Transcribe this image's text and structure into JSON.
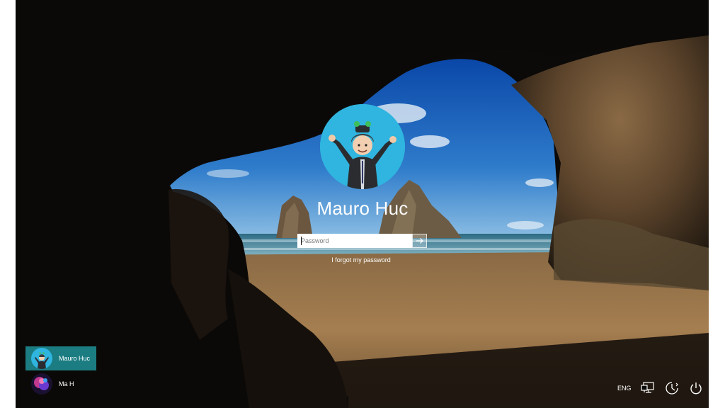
{
  "login": {
    "user_name": "Mauro Huc",
    "password_placeholder": "Password",
    "forgot_password": "I forgot my password",
    "submit_icon": "arrow-right-icon"
  },
  "user_list": [
    {
      "name": "Mauro Huc",
      "selected": true,
      "avatar_icon": "cartoon-avatar-icon"
    },
    {
      "name": "Ma H",
      "selected": false,
      "avatar_icon": "colorful-avatar-icon"
    }
  ],
  "tray": {
    "language": "ENG",
    "network_icon": "network-icon",
    "accessibility_icon": "ease-of-access-icon",
    "power_icon": "power-icon"
  },
  "colors": {
    "selected_user_bg": "#1b7d82",
    "avatar_bg": "#2fb5df",
    "text": "#ffffff"
  }
}
